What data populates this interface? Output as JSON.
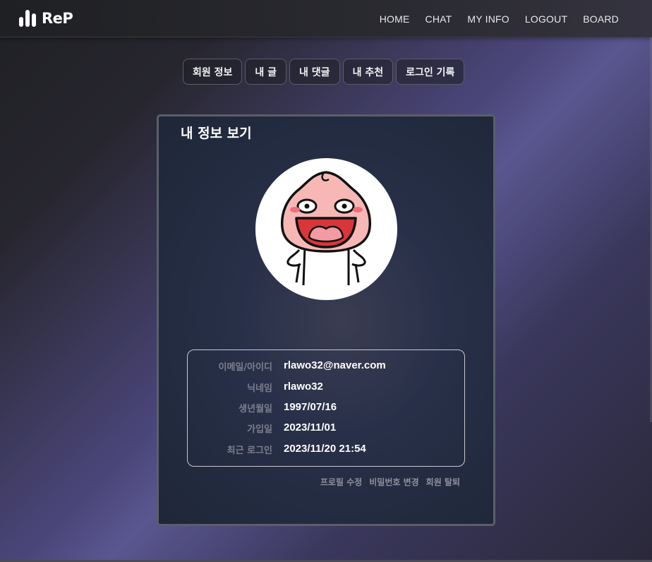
{
  "nav": {
    "logo_text": "ReP",
    "links": [
      "HOME",
      "CHAT",
      "MY INFO",
      "LOGOUT",
      "BOARD"
    ]
  },
  "tabs": [
    "회원 정보",
    "내 글",
    "내 댓글",
    "내 추천",
    "로그인 기록"
  ],
  "card": {
    "title": "내 정보 보기",
    "avatar_icon": "peach-character-avatar",
    "info": [
      {
        "label": "이메일/아이디",
        "value": "rlawo32@naver.com"
      },
      {
        "label": "닉네임",
        "value": "rlawo32"
      },
      {
        "label": "생년월일",
        "value": "1997/07/16"
      },
      {
        "label": "가입일",
        "value": "2023/11/01"
      },
      {
        "label": "최근 로그인",
        "value": "2023/11/20 21:54"
      }
    ],
    "actions": [
      "프로필 수정",
      "비밀번호 변경",
      "회원 탈퇴"
    ]
  },
  "colors": {
    "accent_purple": "#5a5690",
    "card_border": "#5a5f69",
    "label_gray": "#7b7f8d"
  }
}
